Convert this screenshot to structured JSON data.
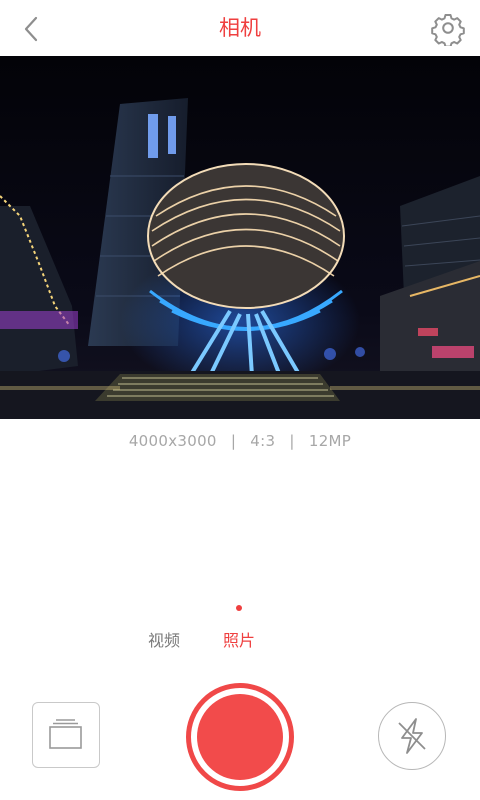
{
  "header": {
    "title": "相机",
    "back_icon": "chevron-left-icon",
    "settings_icon": "gear-icon"
  },
  "preview": {
    "description": "night city photo preview"
  },
  "info": {
    "resolution": "4000x3000",
    "separator": "|",
    "aspect_ratio": "4:3",
    "megapixels": "12MP"
  },
  "modes": {
    "video_label": "视频",
    "photo_label": "照片",
    "active": "照片"
  },
  "controls": {
    "gallery_icon": "gallery-icon",
    "shutter_icon": "shutter-icon",
    "flash_icon": "flash-off-icon"
  },
  "colors": {
    "accent": "#ef3f3f",
    "muted_text": "#a7a7a7",
    "inactive_mode": "#7a7a7a"
  }
}
